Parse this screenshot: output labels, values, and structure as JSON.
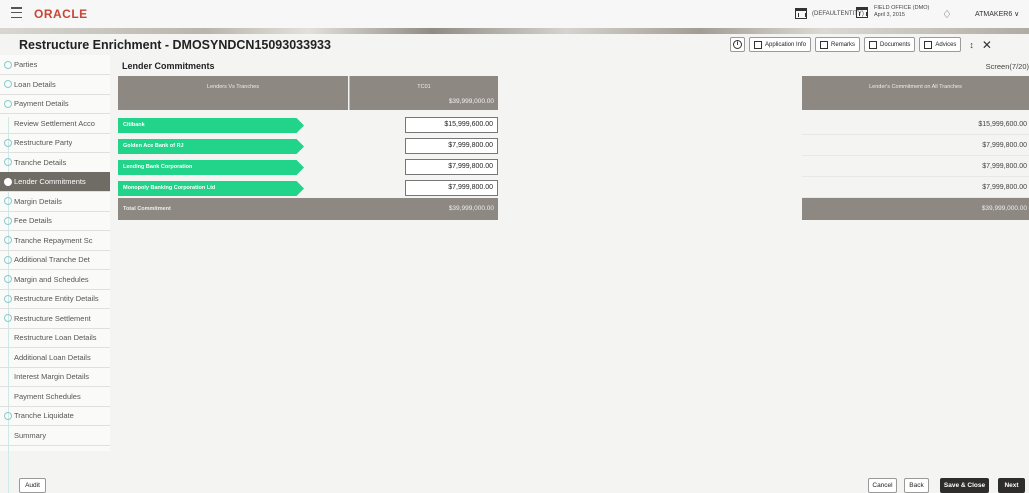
{
  "header": {
    "logo": "ORACLE",
    "entity": "(DEFAULTENTITY)",
    "office_name": "FIELD OFFICE (DMO)",
    "office_date": "April 3, 2015",
    "user": "ATMAKER6"
  },
  "page": {
    "title": "Restructure Enrichment - DMOSYNDCN15093033933",
    "actions": {
      "application_info": "Application Info",
      "remarks": "Remarks",
      "documents": "Documents",
      "advices": "Advices"
    }
  },
  "sidebar": {
    "items": [
      {
        "label": "Parties",
        "status": "done"
      },
      {
        "label": "Loan Details",
        "status": "done"
      },
      {
        "label": "Payment Details",
        "status": "done"
      },
      {
        "label": "Review Settlement Acco",
        "status": "pending"
      },
      {
        "label": "Restructure Party",
        "status": "done"
      },
      {
        "label": "Tranche Details",
        "status": "done"
      },
      {
        "label": "Lender Commitments",
        "status": "active"
      },
      {
        "label": "Margin Details",
        "status": "done"
      },
      {
        "label": "Fee Details",
        "status": "done"
      },
      {
        "label": "Tranche Repayment Sc",
        "status": "done"
      },
      {
        "label": "Additional Tranche Det",
        "status": "done"
      },
      {
        "label": "Margin and Schedules",
        "status": "done"
      },
      {
        "label": "Restructure Entity Details",
        "status": "done"
      },
      {
        "label": "Restructure Settlement",
        "status": "done"
      },
      {
        "label": "Restructure Loan Details",
        "status": "pending"
      },
      {
        "label": "Additional Loan Details",
        "status": "pending"
      },
      {
        "label": "Interest Margin Details",
        "status": "pending"
      },
      {
        "label": "Payment Schedules",
        "status": "pending"
      },
      {
        "label": "Tranche Liquidate",
        "status": "done"
      },
      {
        "label": "Summary",
        "status": "pending"
      }
    ]
  },
  "main": {
    "section_title": "Lender Commitments",
    "screen_indicator": "Screen(7/20)",
    "table": {
      "col_lenders": "Lenders Vs Tranches",
      "col_tranche": "TC01",
      "tranche_total": "$39,999,000.00",
      "col_all_tranches": "Lender's Commitment on All Tranches",
      "rows": [
        {
          "lender": "Citibank",
          "amount": "$15,999,600.00",
          "all_tranches": "$15,999,600.00"
        },
        {
          "lender": "Golden Ace Bank of RJ",
          "amount": "$7,999,800.00",
          "all_tranches": "$7,999,800.00"
        },
        {
          "lender": "Lending Bank Corporation",
          "amount": "$7,999,800.00",
          "all_tranches": "$7,999,800.00"
        },
        {
          "lender": "Monopoly Banking Corporation Ltd",
          "amount": "$7,999,800.00",
          "all_tranches": "$7,999,800.00"
        }
      ],
      "total_label": "Total Commitment",
      "total_amount": "$39,999,000.00",
      "total_all_tranches": "$39,999,000.00"
    }
  },
  "footer": {
    "audit": "Audit",
    "cancel": "Cancel",
    "back": "Back",
    "save_close": "Save & Close",
    "next": "Next"
  }
}
